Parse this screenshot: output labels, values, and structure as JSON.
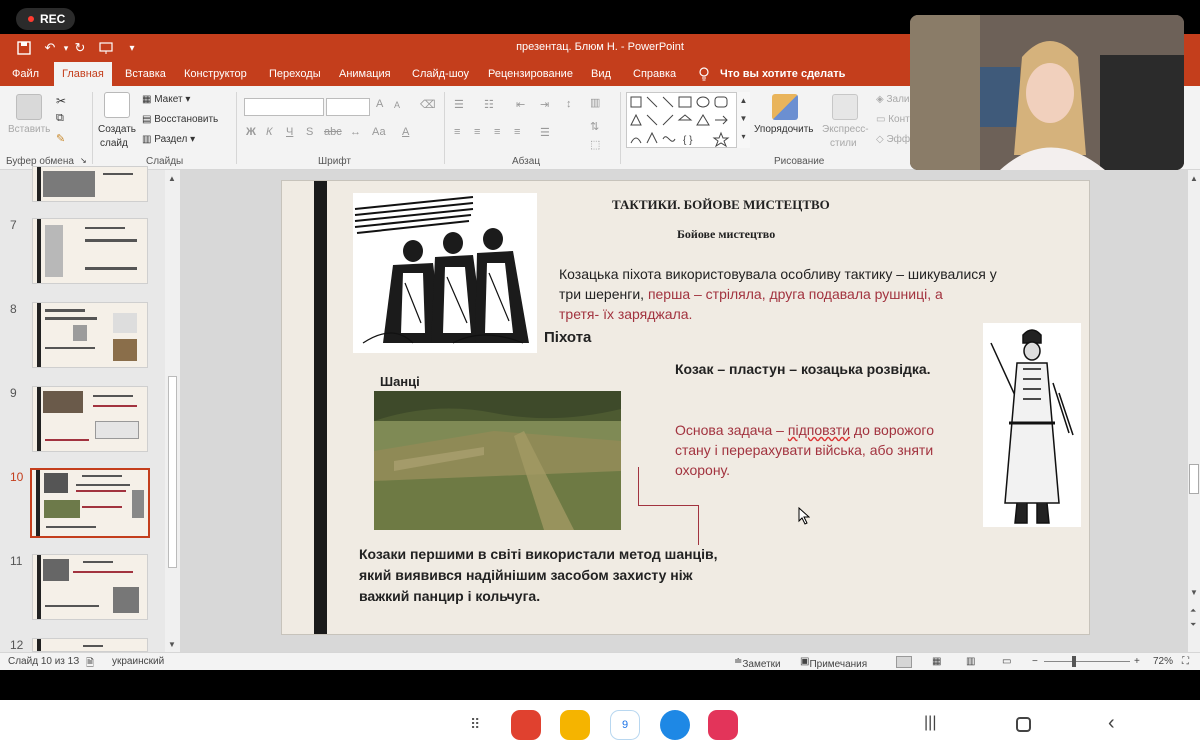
{
  "recording": {
    "label": "REC"
  },
  "window": {
    "title": "презентац. Блюм Н.  -  PowerPoint"
  },
  "menu": {
    "tabs": [
      "Файл",
      "Главная",
      "Вставка",
      "Конструктор",
      "Переходы",
      "Анимация",
      "Слайд-шоу",
      "Рецензирование",
      "Вид",
      "Справка"
    ],
    "active_tab": "Главная",
    "tell_me": "Что вы хотите сделать"
  },
  "ribbon": {
    "clipboard": {
      "paste": "Вставить",
      "label": "Буфер обмена"
    },
    "slides": {
      "new_slide": "Создать",
      "new_slide_2": "слайд",
      "layout": "Макет",
      "reset": "Восстановить",
      "section": "Раздел",
      "label": "Слайды"
    },
    "font": {
      "bold": "Ж",
      "italic": "К",
      "underline": "Ч",
      "strike": "S",
      "spacing": "abc",
      "case": "Аа",
      "label": "Шрифт"
    },
    "paragraph": {
      "label": "Абзац"
    },
    "drawing": {
      "arrange": "Упорядочить",
      "quick_styles": "Экспресс-",
      "quick_styles_2": "стили",
      "label": "Рисование"
    },
    "editing": {
      "fill": "Зали",
      "outline": "Конт",
      "effects": "Эфф"
    }
  },
  "slides_panel": {
    "numbers": [
      "7",
      "8",
      "9",
      "10",
      "11",
      "12"
    ],
    "selected": "10"
  },
  "slide": {
    "title": "ТАКТИКИ. БОЙОВЕ МИСТЕЦТВО",
    "subtitle": "Бойове мистецтво",
    "para1_black": "Козацька піхота використовувала особливу тактику – шикувалися у",
    "para1_line2_black": "три шеренги, ",
    "para1_line2_red": "перша – стріляла, друга подавала рушниці, а",
    "para1_line3_red": "третя- їх заряджала.",
    "infantry_caption": "Піхота",
    "trenches_caption": "Шанці",
    "plastun": "Козак – пластун – козацька розвідка.",
    "task_line1": "Основа задача – ",
    "task_link": "підповзти",
    "task_line1_end": " до ворожого",
    "task_line2": "стану і перерахувати війська, або зняти",
    "task_line3": "охорону.",
    "bottom_line1": "Козаки першими в світі використали метод шанців,",
    "bottom_line2": "який виявився надійнішим засобом захисту ніж",
    "bottom_line3": "важкий панцир і кольчуга."
  },
  "status": {
    "slide_counter": "Слайд 10 из 1З",
    "language": "украинский",
    "notes": "Заметки",
    "comments": "Примечания",
    "zoom": "72%"
  },
  "colors": {
    "accent": "#c43e1c",
    "slide_red": "#a2333f"
  }
}
